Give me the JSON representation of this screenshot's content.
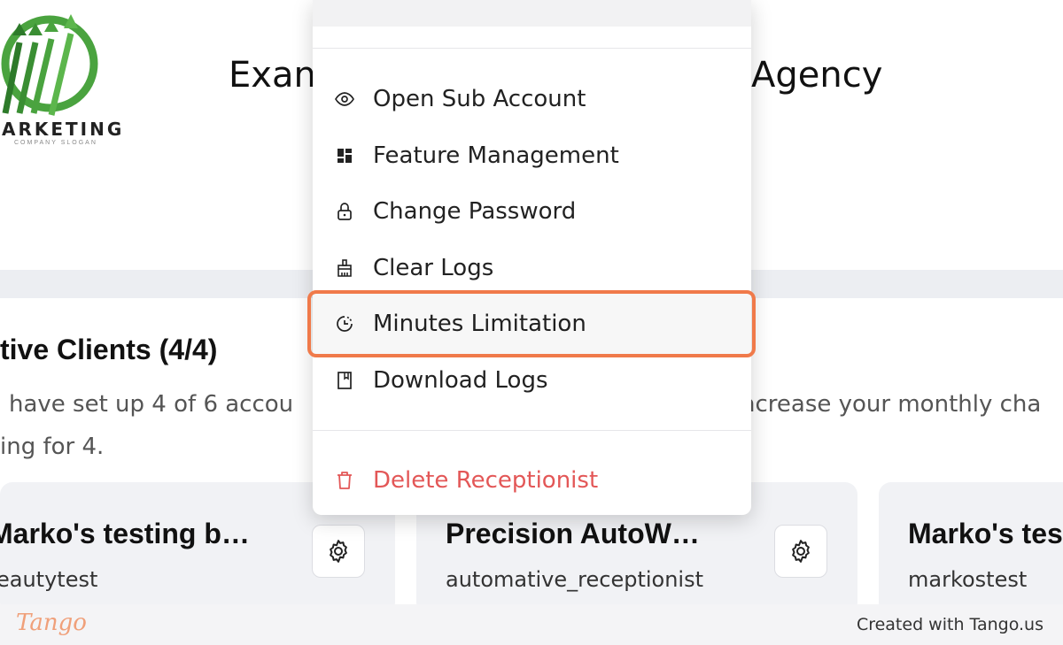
{
  "header": {
    "logo_text": "ARKETING",
    "logo_slogan": "COMPANY SLOGAN",
    "title_left": "Exan",
    "title_right": "Agency"
  },
  "clients": {
    "title": "tive Clients (4/4)",
    "desc_line1_left": "have set up 4 of 6 accou",
    "desc_line1_right": "ncrease your monthly cha",
    "desc_line2": "ing for 4.",
    "cards": [
      {
        "name": "Marko's testing b…",
        "sub": "eautytest"
      },
      {
        "name": "Precision AutoW…",
        "sub": "automative_receptionist"
      },
      {
        "name": "Marko's tes",
        "sub": "markostest"
      }
    ]
  },
  "menu": {
    "items": [
      {
        "label": "Open Sub Account",
        "icon": "eye-icon"
      },
      {
        "label": "Feature Management",
        "icon": "grid-icon"
      },
      {
        "label": "Change Password",
        "icon": "lock-icon"
      },
      {
        "label": "Clear Logs",
        "icon": "broom-icon"
      },
      {
        "label": "Minutes Limitation",
        "icon": "timer-icon"
      },
      {
        "label": "Download Logs",
        "icon": "file-icon"
      }
    ],
    "danger_item": {
      "label": "Delete Receptionist",
      "icon": "trash-icon"
    }
  },
  "footer": {
    "tango": "Tango",
    "created_with": "Created with Tango.us"
  },
  "colors": {
    "highlight": "#f07a4a",
    "danger": "#e35757",
    "logo_green": "#3f9a3a"
  }
}
